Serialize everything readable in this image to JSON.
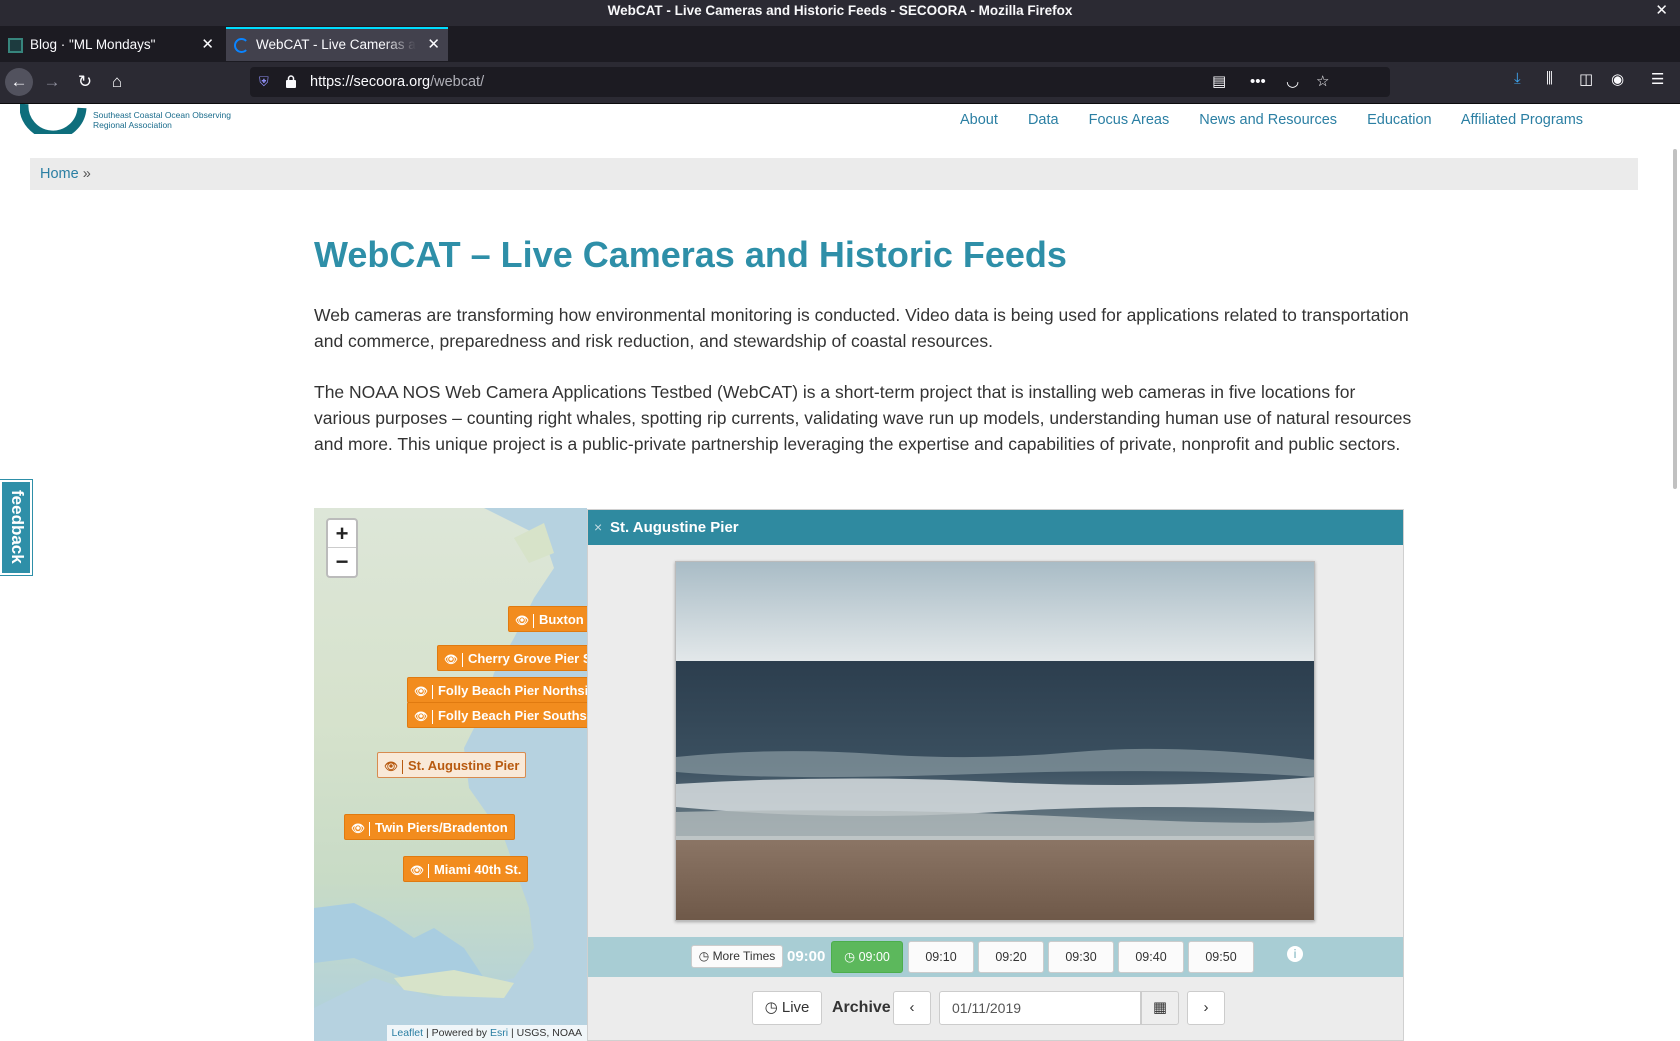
{
  "browser": {
    "window_title": "WebCAT - Live Cameras and Historic Feeds - SECOORA - Mozilla Firefox",
    "tabs": [
      {
        "title": "Blog · \"ML Mondays\""
      },
      {
        "title": "WebCAT - Live Cameras and Historic Feeds"
      }
    ],
    "url_host": "https://secoora.org",
    "url_path": "/webcat/",
    "icons": [
      "back-arrow",
      "forward-arrow",
      "reload",
      "home",
      "tracking-shield",
      "lock",
      "reader-view",
      "page-actions",
      "pocket",
      "bookmark-star",
      "downloads",
      "library",
      "sidebar",
      "account",
      "menu"
    ]
  },
  "site": {
    "logo_text_line1": "Southeast Coastal Ocean Observing",
    "logo_text_line2": "Regional Association",
    "nav": [
      "About",
      "Data",
      "Focus Areas",
      "News and Resources",
      "Education",
      "Affiliated Programs"
    ],
    "breadcrumb_home": "Home",
    "breadcrumb_sep": "»",
    "feedback_label": "feedback"
  },
  "main": {
    "title": "WebCAT – Live Cameras and Historic Feeds",
    "paragraph1": "Web cameras are transforming how environmental monitoring is conducted. Video data is being used for applications related to transportation and commerce, preparedness and risk reduction, and stewardship of coastal resources.",
    "paragraph2": "The NOAA NOS Web Camera Applications Testbed (WebCAT) is a short-term project that is installing web cameras in five locations for various purposes – counting right whales, spotting rip currents, validating wave run up models, understanding human use of natural resources and more. This unique project is a public-private partnership leveraging the expertise and capabilities of private, nonprofit and public sectors."
  },
  "map": {
    "zoom_in": "+",
    "zoom_out": "−",
    "markers": [
      {
        "label": "Buxton Coast Guard"
      },
      {
        "label": "Cherry Grove Pier South"
      },
      {
        "label": "Folly Beach Pier Northside"
      },
      {
        "label": "Folly Beach Pier Southside"
      },
      {
        "label": "St. Augustine Pier",
        "active": true
      },
      {
        "label": "Twin Piers/Bradenton"
      },
      {
        "label": "Miami 40th St."
      }
    ],
    "attribution_leaflet": "Leaflet",
    "attribution_mid": " | Powered by ",
    "attribution_esri": "Esri",
    "attribution_end": " | USGS, NOAA"
  },
  "camera": {
    "title": "St. Augustine Pier",
    "close_glyph": "×",
    "more_times": "More Times",
    "current_time": "09:00",
    "times": [
      "09:00",
      "09:10",
      "09:20",
      "09:30",
      "09:40",
      "09:50"
    ],
    "selected_time": "09:00",
    "live_label": "Live",
    "archive_label": "Archive",
    "date": "01/11/2019"
  },
  "colors": {
    "title_teal": "#2e8fa8",
    "marker_orange": "#f28c1e",
    "timebar": "#a8cdd4",
    "selected_time_green": "#5cb85c"
  }
}
